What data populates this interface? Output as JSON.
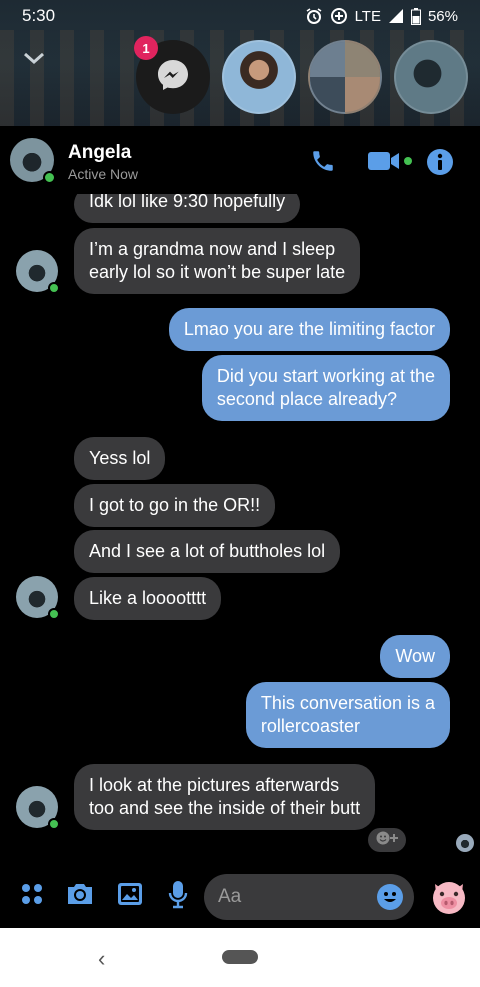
{
  "status_bar": {
    "time": "5:30",
    "network": "LTE",
    "battery": "56%"
  },
  "chat_heads": {
    "badge_count": "1"
  },
  "header": {
    "name": "Angela",
    "status": "Active Now"
  },
  "messages": [
    {
      "text": "Idk lol like 9:30 hopefully",
      "dir": "in"
    },
    {
      "text": "I’m a grandma now and I sleep",
      "text2": "early lol so it won’t be super late",
      "dir": "in"
    },
    {
      "text": "Lmao you are the limiting factor",
      "dir": "out"
    },
    {
      "text": "Did you start working at the",
      "text2": "second place already?",
      "dir": "out"
    },
    {
      "text": "Yess lol",
      "dir": "in"
    },
    {
      "text": "I got to go in the OR!!",
      "dir": "in"
    },
    {
      "text": "And I see a lot of buttholes lol",
      "dir": "in"
    },
    {
      "text": "Like a looootttt",
      "dir": "in"
    },
    {
      "text": "Wow",
      "dir": "out"
    },
    {
      "text": "This conversation is a",
      "text2": "rollercoaster",
      "dir": "out"
    },
    {
      "text": "I look at the pictures afterwards",
      "text2": "too and see the inside of their butt",
      "dir": "in"
    }
  ],
  "composer": {
    "placeholder": "Aa"
  },
  "colors": {
    "outgoing": "#6b9bd6",
    "incoming": "#3a3a3c",
    "accent": "#5b9ee8",
    "online": "#44c152"
  },
  "icons": [
    "chevron-down-icon",
    "messenger-icon",
    "phone-icon",
    "video-icon",
    "info-icon",
    "apps-icon",
    "camera-icon",
    "gallery-icon",
    "mic-icon",
    "emoji-icon",
    "pig-icon"
  ]
}
